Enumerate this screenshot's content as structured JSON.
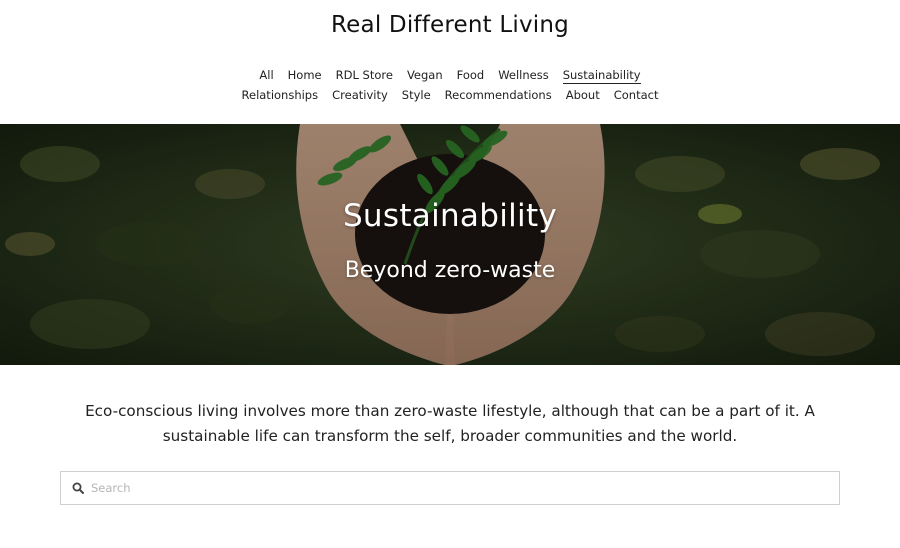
{
  "site": {
    "title": "Real Different Living"
  },
  "nav": {
    "row1": [
      "All",
      "Home",
      "RDL Store",
      "Vegan",
      "Food",
      "Wellness",
      "Sustainability"
    ],
    "row2": [
      "Relationships",
      "Creativity",
      "Style",
      "Recommendations",
      "About",
      "Contact"
    ],
    "active": "Sustainability"
  },
  "hero": {
    "title": "Sustainability",
    "subtitle": "Beyond zero-waste"
  },
  "intro": {
    "text": "Eco-conscious living involves more than zero-waste lifestyle, although that can be a part of it. A sustainable life can transform the self, broader communities and the world."
  },
  "search": {
    "placeholder": "Search",
    "value": ""
  },
  "icons": {
    "search": "search-icon"
  }
}
